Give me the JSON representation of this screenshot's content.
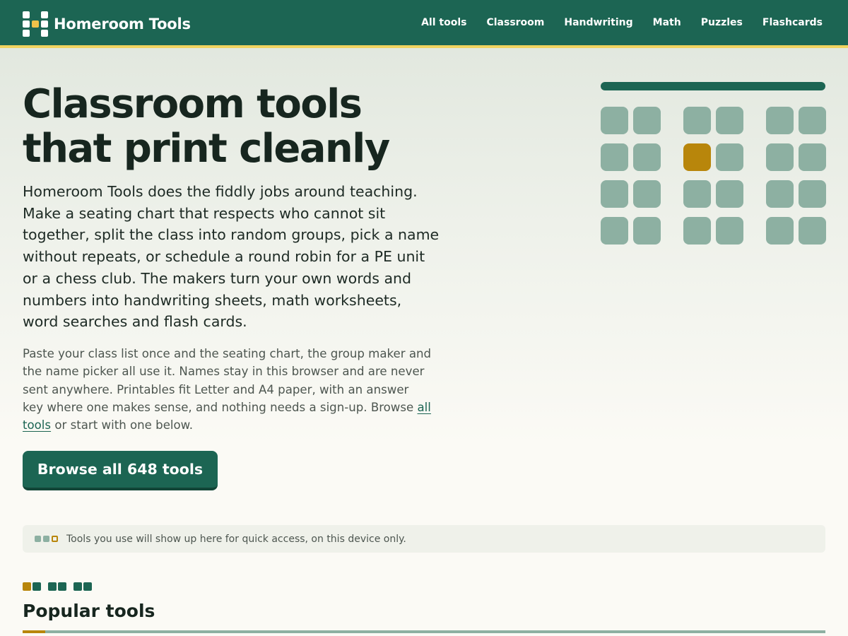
{
  "brand": {
    "name": "Homeroom Tools",
    "accent_color": "#1c6553",
    "highlight_color": "#f0d35f",
    "gold_color": "#b8860b"
  },
  "nav": [
    {
      "label": "All tools"
    },
    {
      "label": "Classroom"
    },
    {
      "label": "Handwriting"
    },
    {
      "label": "Math"
    },
    {
      "label": "Puzzles"
    },
    {
      "label": "Flashcards"
    }
  ],
  "hero": {
    "title_line1": "Classroom tools",
    "title_line2": "that print cleanly",
    "lead": "Homeroom Tools does the fiddly jobs around teaching. Make a seating chart that respects who cannot sit together, split the class into random groups, pick a name without repeats, or schedule a round robin for a PE unit or a chess club. The makers turn your own words and numbers into handwriting sheets, math worksheets, word searches and flash cards.",
    "sub_text_before": "Paste your class list once and the seating chart, the group maker and the name picker all use it. Names stay in this browser and are never sent anywhere. Printables fit Letter and A4 paper, with an answer key where one makes sense, and nothing needs a sign-up. Browse ",
    "sub_link": "all tools",
    "sub_text_after": " or start with one below.",
    "cta_label": "Browse all 648 tools"
  },
  "illustration": {
    "icon": "seating-chart-icon",
    "rows": 4,
    "desks_per_row": 6,
    "highlighted_desk": {
      "row": 2,
      "desk": 3
    }
  },
  "recent": {
    "icon": "recent-tools-icon",
    "text": "Tools you use will show up here for quick access, on this device only."
  },
  "popular": {
    "title": "Popular tools"
  }
}
